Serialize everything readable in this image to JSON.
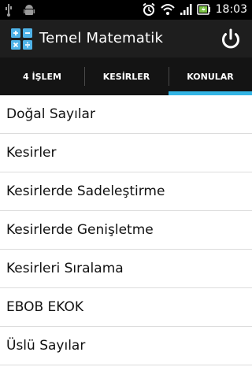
{
  "status_bar": {
    "time": "18:03",
    "icons": [
      "usb-icon",
      "android-debug-icon",
      "alarm-icon",
      "wifi-icon",
      "signal-icon",
      "battery-icon"
    ]
  },
  "app": {
    "title": "Temel Matematik",
    "icon": "calculator-icon",
    "action_icon": "power-icon"
  },
  "tabs": [
    {
      "label": "4 İŞLEM"
    },
    {
      "label": "KESİRLER"
    },
    {
      "label": "KONULAR",
      "selected": true
    }
  ],
  "topics": [
    {
      "label": "Doğal Sayılar"
    },
    {
      "label": "Kesirler"
    },
    {
      "label": "Kesirlerde Sadeleştirme"
    },
    {
      "label": "Kesirlerde Genişletme"
    },
    {
      "label": "Kesirleri Sıralama"
    },
    {
      "label": "EBOB EKOK"
    },
    {
      "label": "Üslü Sayılar"
    }
  ],
  "colors": {
    "accent": "#33b5e5",
    "action_bar": "#1e1e1e",
    "tab_bar": "#141414"
  }
}
